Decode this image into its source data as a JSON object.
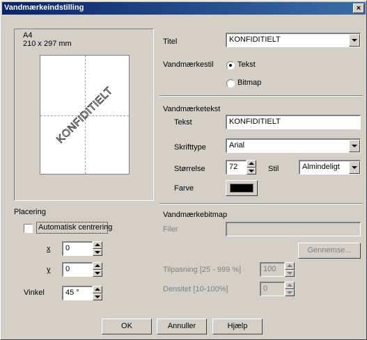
{
  "window": {
    "title": "Vandmærkeindstilling",
    "close_glyph": "×"
  },
  "preview": {
    "paper_size": "A4",
    "paper_dims": "210 x 297 mm",
    "watermark_text": "KONFIDITIELT"
  },
  "placement": {
    "group_label": "Placering",
    "auto_center_label": "Automatisk centrering",
    "auto_center_checked": false,
    "x_label": "x",
    "x_value": "0",
    "y_label": "y",
    "y_value": "0",
    "angle_label": "Vinkel",
    "angle_value": "45 °"
  },
  "title_field": {
    "label": "Titel",
    "value": "KONFIDITIELT"
  },
  "style": {
    "label": "Vandmærkestil",
    "options": [
      "Tekst",
      "Bitmap"
    ],
    "selected": "Tekst"
  },
  "text_group": {
    "group_label": "Vandmærketekst",
    "text_label": "Tekst",
    "text_value": "KONFIDITIELT",
    "font_label": "Skrifttype",
    "font_value": "Arial",
    "size_label": "Størrelse",
    "size_value": "72",
    "style_label": "Stil",
    "style_value": "Almindeligt",
    "color_label": "Farve",
    "color_value": "#000000"
  },
  "bitmap_group": {
    "group_label": "Vandmærkebitmap",
    "file_label": "Filer",
    "file_value": "",
    "browse_label": "Gennemse...",
    "scale_label": "Tilpasning [25 - 999 %]",
    "scale_value": "100",
    "density_label": "Densitet [10-100%]",
    "density_value": "0"
  },
  "buttons": {
    "ok": "OK",
    "cancel": "Annuller",
    "help": "Hjælp"
  },
  "colors": {
    "titlebar_start": "#0a246a",
    "titlebar_end": "#3a6ea5",
    "face": "#d4d0c8"
  }
}
